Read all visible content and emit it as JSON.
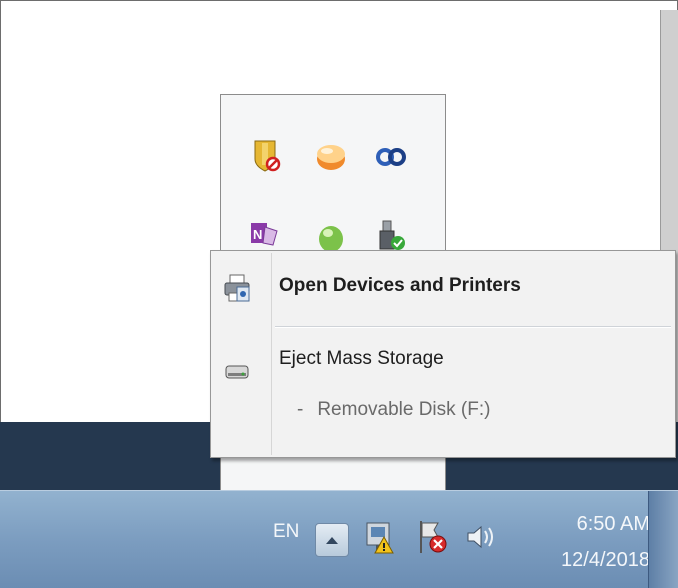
{
  "overflow": {
    "icons": [
      "shield-security-icon",
      "orange-disc-icon",
      "infinity-link-icon",
      "onenote-icon",
      "green-orb-icon",
      "usb-drive-check-icon"
    ]
  },
  "context_menu": {
    "item_open": "Open Devices and Printers",
    "item_eject": "Eject Mass Storage",
    "sub_dash": "-",
    "sub_disk": "Removable Disk (F:)"
  },
  "taskbar": {
    "language": "EN",
    "time": "6:50 AM",
    "date": "12/4/2018"
  }
}
